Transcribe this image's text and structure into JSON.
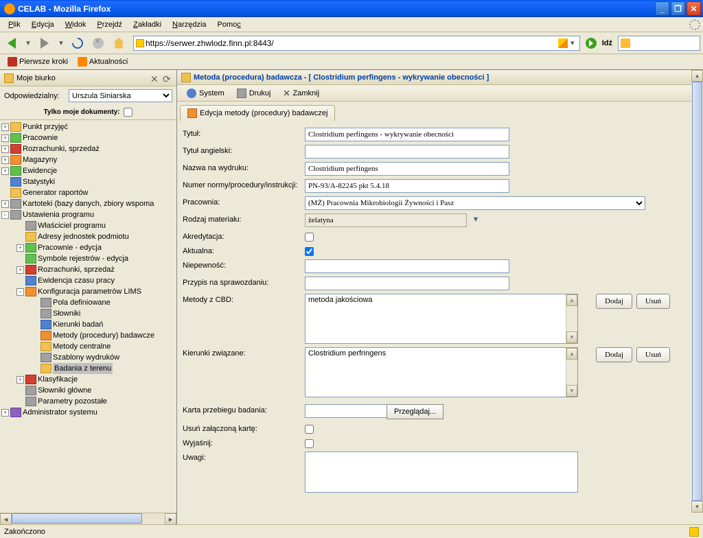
{
  "window": {
    "title": "CELAB - Mozilla Firefox"
  },
  "menu": {
    "file": "Plik",
    "edit": "Edycja",
    "view": "Widok",
    "go": "Przejdź",
    "bookmarks": "Zakładki",
    "tools": "Narzędzia",
    "help": "Pomoc"
  },
  "nav": {
    "url": "https://serwer.zhwlodz.finn.pl:8443/",
    "go": "Idź"
  },
  "bookmarks": {
    "first": "Pierwsze kroki",
    "news": "Aktualności"
  },
  "sidebar": {
    "header": "Moje biurko",
    "resp_lbl": "Odpowiedzialny:",
    "resp_val": "Urszula Siniarska",
    "onlymine": "Tylko moje dokumenty:",
    "tree": {
      "n1": "Punkt przyjęć",
      "n2": "Pracownie",
      "n3": "Rozrachunki, sprzedaż",
      "n4": "Magazyny",
      "n5": "Ewidencje",
      "n6": "Statystyki",
      "n7": "Generator raportów",
      "n8": "Kartoteki (bazy danych, zbiory wspoma",
      "n9": "Ustawienia programu",
      "n9a": "Właściciel programu",
      "n9b": "Adresy jednostek podmiotu",
      "n9c": "Pracownie - edycja",
      "n9d": "Symbole rejestrów - edycja",
      "n9e": "Rozrachunki, sprzedaż",
      "n9f": "Ewidencja czasu pracy",
      "n9g": "Konfiguracja parametrów LIMS",
      "n9g1": "Pola definiowane",
      "n9g2": "Słowniki",
      "n9g3": "Kierunki badań",
      "n9g4": "Metody (procedury) badawcze",
      "n9g5": "Metody centralne",
      "n9g6": "Szablony wydruków",
      "n9g7": "Badania z terenu",
      "n9h": "Klasyfikacje",
      "n9i": "Słowniki główne",
      "n9j": "Parametry pozostałe",
      "n10": "Administrator systemu"
    }
  },
  "main": {
    "title": "Metoda (procedura) badawcza - [ Clostridium perfingens - wykrywanie obecności ]",
    "tb_system": "System",
    "tb_print": "Drukuj",
    "tb_close": "Zamknij",
    "tab": "Edycja metody (procedury) badawczej",
    "f": {
      "tytul_l": "Tytuł:",
      "tytul_v": "Clostridium perfingens - wykrywanie obecności",
      "tytulang_l": "Tytuł angielski:",
      "tytulang_v": "",
      "nazwawyd_l": "Nazwa na wydruku:",
      "nazwawyd_v": "Clostridium perfingens",
      "norma_l": "Numer normy/procedury/instrukcji:",
      "norma_v": "PN-93/A-82245 pkt 5.4.18",
      "prac_l": "Pracownia:",
      "prac_v": "(MŻ) Pracownia Mikrobiologii Żywności i Pasz",
      "rodzaj_l": "Rodzaj materiału:",
      "rodzaj_v": "żelatyna",
      "akr_l": "Akredytacja:",
      "akt_l": "Aktualna:",
      "niep_l": "Niepewność:",
      "niep_v": "",
      "przypis_l": "Przypis na sprawozdaniu:",
      "przypis_v": "",
      "cbd_l": "Metody z CBD:",
      "cbd_v": "metoda jakościowa",
      "kier_l": "Kierunki związane:",
      "kier_v": "Clostridium perfringens",
      "karta_l": "Karta przebiegu badania:",
      "karta_btn": "Przeglądaj...",
      "usun_l": "Usuń załączoną kartę:",
      "wyj_l": "Wyjaśnij:",
      "uwagi_l": "Uwagi:",
      "btn_add": "Dodaj",
      "btn_del": "Usuń"
    }
  },
  "status": "Zakończono"
}
